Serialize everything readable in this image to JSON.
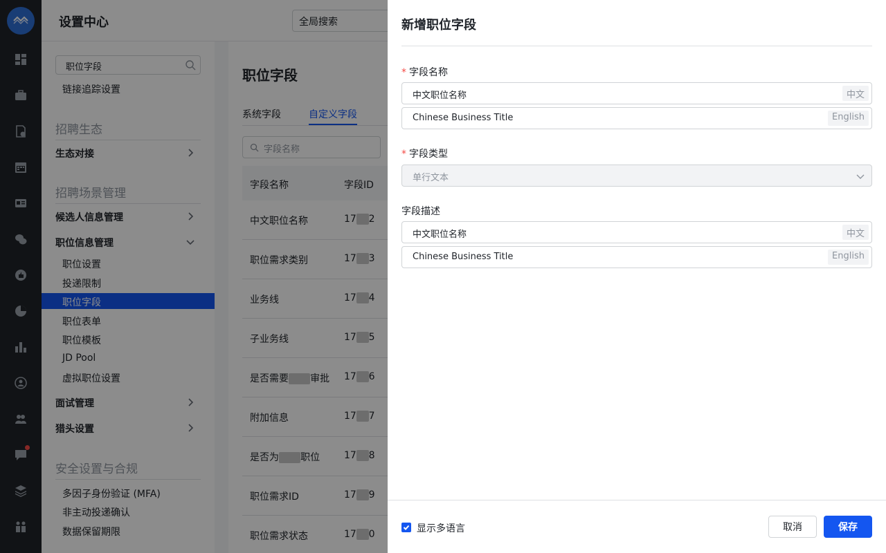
{
  "app": {
    "title": "设置中心",
    "global_search_placeholder": "全局搜索"
  },
  "rail_icons": [
    "dashboard-icon",
    "briefcase-icon",
    "document-lock-icon",
    "calendar-icon",
    "id-card-icon",
    "wechat-icon",
    "thumbs-up-icon",
    "pie-chart-icon",
    "bar-chart-icon",
    "user-circle-icon",
    "team-icon",
    "chat-icon",
    "layers-icon",
    "org-icon"
  ],
  "settings_nav": {
    "search_value": "职位字段",
    "link_tracking": "链接追踪设置",
    "sections": {
      "ecosystem": "招聘生态",
      "ecosystem_group": "生态对接",
      "scenario": "招聘场景管理",
      "candidate_group": "候选人信息管理",
      "job_group": "职位信息管理",
      "job_items": [
        "职位设置",
        "投递限制",
        "职位字段",
        "职位表单",
        "职位模板",
        "JD Pool",
        "虚拟职位设置"
      ],
      "interview_group": "面试管理",
      "headhunter_group": "猎头设置",
      "security": "安全设置与合规",
      "security_items": [
        "多因子身份验证 (MFA)",
        "非主动投递确认",
        "数据保留期限"
      ]
    }
  },
  "main": {
    "page_title": "职位字段",
    "tabs": [
      "系统字段",
      "自定义字段"
    ],
    "active_tab": "自定义字段",
    "search_placeholder": "字段名称",
    "columns": [
      "字段名称",
      "字段ID"
    ],
    "rows": [
      {
        "name": "中文职位名称",
        "id_prefix": "17",
        "id_suffix": "2"
      },
      {
        "name": "职位需求类别",
        "id_prefix": "17",
        "id_suffix": "3"
      },
      {
        "name": "业务线",
        "id_prefix": "17",
        "id_suffix": "4"
      },
      {
        "name": "子业务线",
        "id_prefix": "17",
        "id_suffix": "5"
      },
      {
        "name_a": "是否需要",
        "name_b": "审批",
        "id_prefix": "17",
        "id_suffix": "6"
      },
      {
        "name": "附加信息",
        "id_prefix": "17",
        "id_suffix": "7"
      },
      {
        "name_a": "是否为",
        "name_b": "职位",
        "id_prefix": "17",
        "id_suffix": "8"
      },
      {
        "name": "职位需求ID",
        "id_prefix": "17",
        "id_suffix": "9"
      },
      {
        "name": "职位需求状态",
        "id_prefix": "17",
        "id_suffix": "0"
      }
    ]
  },
  "drawer": {
    "title": "新增职位字段",
    "required_mark": "*",
    "field_name_label": "字段名称",
    "field_name_zh": "中文职位名称",
    "field_name_en": "Chinese Business Title",
    "lang_zh": "中文",
    "lang_en": "English",
    "field_type_label": "字段类型",
    "field_type_value": "单行文本",
    "field_desc_label": "字段描述",
    "field_desc_zh": "中文职位名称",
    "field_desc_en": "Chinese Business Title",
    "show_multilang": "显示多语言",
    "cancel": "取消",
    "save": "保存"
  },
  "colors": {
    "primary": "#1456f0",
    "rail": "#1f2329",
    "required": "#f54a45"
  }
}
